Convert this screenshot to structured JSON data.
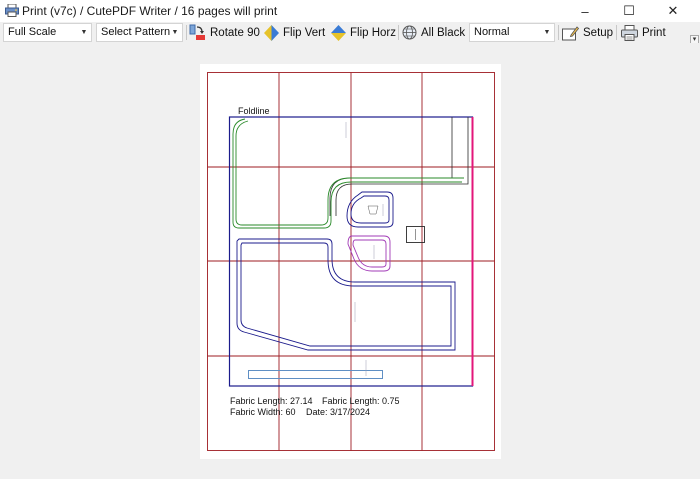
{
  "window": {
    "title": "Print (v7c)  /  CutePDF Writer  /  16 pages will print",
    "minimize": "–",
    "maximize": "☐",
    "close": "✕"
  },
  "toolbar": {
    "scale_value": "Full Scale",
    "pattern_value": "Select Pattern",
    "rotate_label": "Rotate 90",
    "flip_vert_label": "Flip Vert",
    "flip_horz_label": "Flip Horz",
    "all_black_label": "All Black",
    "mode_value": "Normal",
    "setup_label": "Setup",
    "print_label": "Print",
    "combo_arrow": "▼",
    "scroll_arrow": "▾"
  },
  "preview": {
    "foldline_label": "Foldline",
    "fabric_length_1": "Fabric Length: 27.14",
    "fabric_width": "Fabric Width: 60",
    "fabric_length_2": "Fabric Length: 0.75",
    "date": "Date:  3/17/2024"
  },
  "colors": {
    "grid": "#9e1b22",
    "outline": "#1b1b8c",
    "foldline": "#e3167a",
    "piece_green": "#2a8a2a",
    "piece_purple": "#a23bb7",
    "strip": "#5f8fc4",
    "piece_dark": "#2b2b2b"
  },
  "icons": {
    "title": "printer-app-icon",
    "rotate": "rotate-icon",
    "flip_vert": "flip-vertical-icon",
    "flip_horz": "flip-horizontal-icon",
    "all_black": "globe-icon",
    "setup": "setup-icon",
    "print": "printer-icon"
  }
}
